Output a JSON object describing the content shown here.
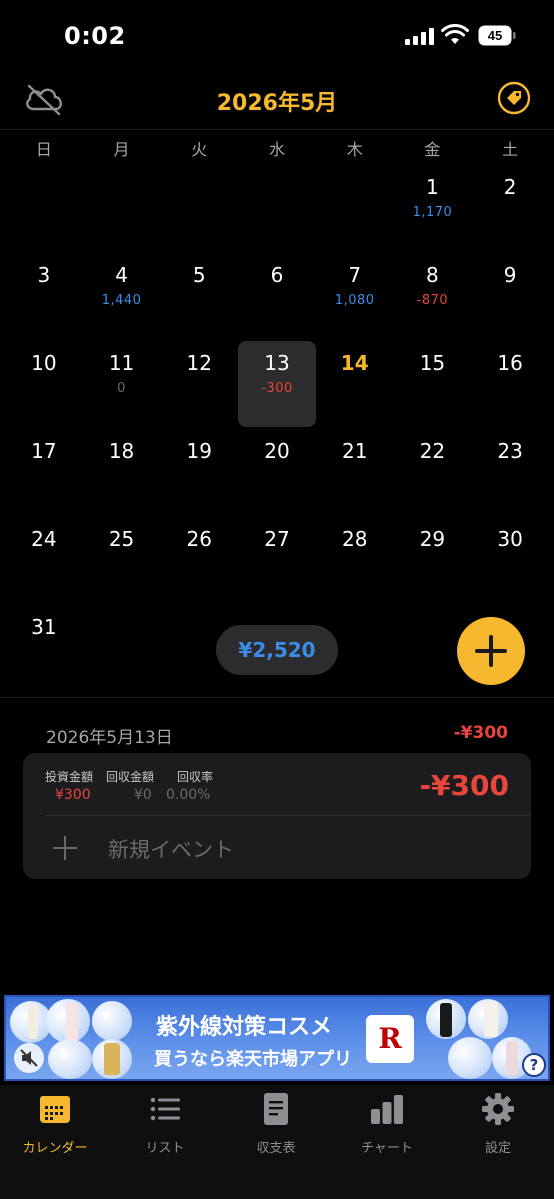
{
  "status_bar": {
    "time": "0:02",
    "battery": "45"
  },
  "header": {
    "title": "2026年5月",
    "cloud_icon": "cloud-off-icon",
    "tag_icon": "tag-icon",
    "accent_color": "#f5b82e"
  },
  "weekdays": [
    "日",
    "月",
    "火",
    "水",
    "木",
    "金",
    "土"
  ],
  "calendar": {
    "days": [
      {
        "day": "",
        "amount": "",
        "kind": ""
      },
      {
        "day": "",
        "amount": "",
        "kind": ""
      },
      {
        "day": "",
        "amount": "",
        "kind": ""
      },
      {
        "day": "",
        "amount": "",
        "kind": ""
      },
      {
        "day": "",
        "amount": "",
        "kind": ""
      },
      {
        "day": "1",
        "amount": "1,170",
        "kind": "pos"
      },
      {
        "day": "2",
        "amount": "",
        "kind": ""
      },
      {
        "day": "3",
        "amount": "",
        "kind": ""
      },
      {
        "day": "4",
        "amount": "1,440",
        "kind": "pos"
      },
      {
        "day": "5",
        "amount": "",
        "kind": ""
      },
      {
        "day": "6",
        "amount": "",
        "kind": ""
      },
      {
        "day": "7",
        "amount": "1,080",
        "kind": "pos"
      },
      {
        "day": "8",
        "amount": "-870",
        "kind": "neg"
      },
      {
        "day": "9",
        "amount": "",
        "kind": ""
      },
      {
        "day": "10",
        "amount": "",
        "kind": ""
      },
      {
        "day": "11",
        "amount": "0",
        "kind": "zero"
      },
      {
        "day": "12",
        "amount": "",
        "kind": ""
      },
      {
        "day": "13",
        "amount": "-300",
        "kind": "neg",
        "selected": true
      },
      {
        "day": "14",
        "amount": "",
        "kind": "",
        "today": true
      },
      {
        "day": "15",
        "amount": "",
        "kind": ""
      },
      {
        "day": "16",
        "amount": "",
        "kind": ""
      },
      {
        "day": "17",
        "amount": "",
        "kind": ""
      },
      {
        "day": "18",
        "amount": "",
        "kind": ""
      },
      {
        "day": "19",
        "amount": "",
        "kind": ""
      },
      {
        "day": "20",
        "amount": "",
        "kind": ""
      },
      {
        "day": "21",
        "amount": "",
        "kind": ""
      },
      {
        "day": "22",
        "amount": "",
        "kind": ""
      },
      {
        "day": "23",
        "amount": "",
        "kind": ""
      },
      {
        "day": "24",
        "amount": "",
        "kind": ""
      },
      {
        "day": "25",
        "amount": "",
        "kind": ""
      },
      {
        "day": "26",
        "amount": "",
        "kind": ""
      },
      {
        "day": "27",
        "amount": "",
        "kind": ""
      },
      {
        "day": "28",
        "amount": "",
        "kind": ""
      },
      {
        "day": "29",
        "amount": "",
        "kind": ""
      },
      {
        "day": "30",
        "amount": "",
        "kind": ""
      },
      {
        "day": "31",
        "amount": "",
        "kind": ""
      }
    ],
    "positive_color": "#3a8ee8",
    "negative_color": "#e8453c"
  },
  "month_total": "¥2,520",
  "add_button_icon": "plus-icon",
  "day_detail": {
    "date": "2026年5月13日",
    "total": "-¥300",
    "investment_label": "投資金額",
    "investment_value": "¥300",
    "return_label": "回収金額",
    "return_value": "¥0",
    "rate_label": "回収率",
    "rate_value": "0.00%",
    "net": "-¥300",
    "new_event": "新規イベント"
  },
  "ad": {
    "line1": "紫外線対策コスメ",
    "line2": "買うなら楽天市場アプリ",
    "brand_mark": "R",
    "help": "?"
  },
  "tabs": [
    {
      "label": "カレンダー",
      "icon": "calendar-icon",
      "active": true
    },
    {
      "label": "リスト",
      "icon": "list-icon"
    },
    {
      "label": "収支表",
      "icon": "document-icon"
    },
    {
      "label": "チャート",
      "icon": "bar-chart-icon"
    },
    {
      "label": "設定",
      "icon": "gear-icon"
    }
  ]
}
